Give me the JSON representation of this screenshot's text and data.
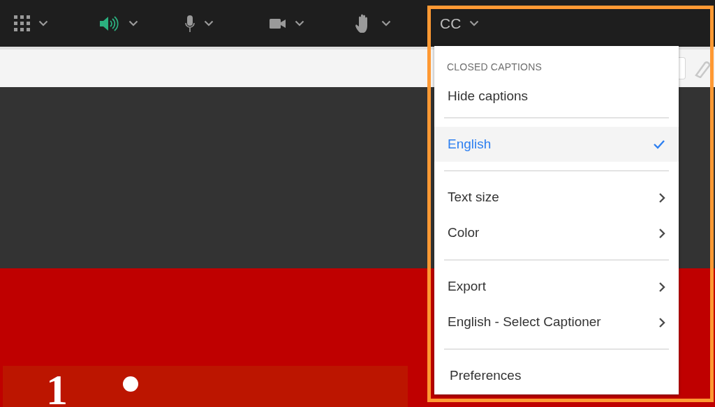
{
  "toolbar": {
    "buttons": [
      {
        "kind": "apps",
        "on": false
      },
      {
        "kind": "speaker",
        "on": true
      },
      {
        "kind": "microphone",
        "on": false
      },
      {
        "kind": "camera",
        "on": false
      },
      {
        "kind": "hand",
        "on": false
      },
      {
        "kind": "captions",
        "label": "CC"
      }
    ]
  },
  "slide": {
    "number": "1"
  },
  "captions_menu": {
    "heading": "CLOSED CAPTIONS",
    "sections": [
      [
        {
          "kind": "action",
          "label": "Hide captions"
        }
      ],
      [
        {
          "kind": "option",
          "label": "English",
          "selected": true
        }
      ],
      [
        {
          "kind": "submenu",
          "label": "Text size"
        },
        {
          "kind": "submenu",
          "label": "Color"
        }
      ],
      [
        {
          "kind": "submenu",
          "label": "Export"
        },
        {
          "kind": "submenu",
          "label": "English - Select Captioner"
        }
      ],
      [
        {
          "kind": "action",
          "label": "Preferences"
        }
      ]
    ]
  }
}
